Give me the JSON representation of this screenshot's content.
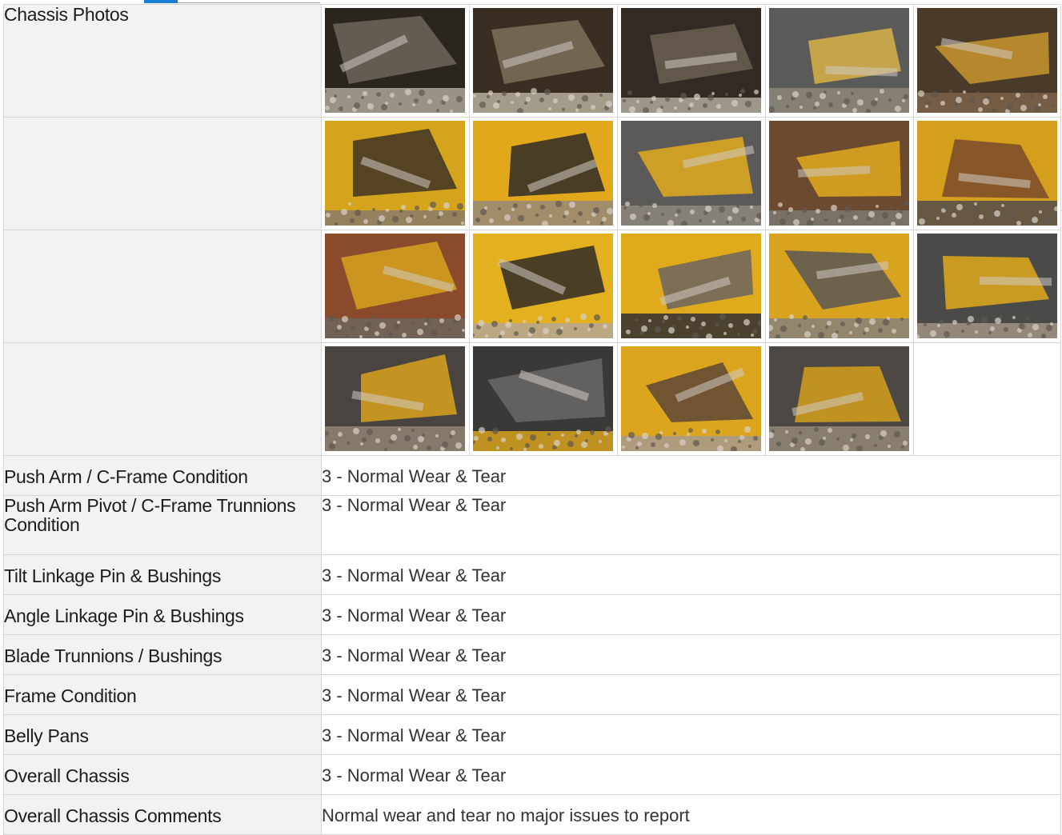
{
  "section": {
    "photos_label": "Chassis Photos"
  },
  "photos": {
    "rows": [
      [
        {
          "icon": "chassis-underside-photo",
          "tone": [
            "#2b2520",
            "#6e665c",
            "#a49e92"
          ]
        },
        {
          "icon": "chassis-underside-photo",
          "tone": [
            "#3a2e22",
            "#7d6e5a",
            "#b0a896"
          ]
        },
        {
          "icon": "chassis-underside-photo",
          "tone": [
            "#322a24",
            "#6b5f52",
            "#a8a296"
          ]
        },
        {
          "icon": "grille-guard-photo",
          "tone": [
            "#5a5a58",
            "#d9b24a",
            "#8a8378"
          ]
        },
        {
          "icon": "linkage-joint-photo",
          "tone": [
            "#4a3a2a",
            "#c9962e",
            "#7a6048"
          ]
        }
      ],
      [
        {
          "icon": "frame-bolt-photo",
          "tone": [
            "#d4a51c",
            "#3d3226",
            "#8d7d66"
          ]
        },
        {
          "icon": "cylinder-mount-photo",
          "tone": [
            "#e0a81a",
            "#2e2b28",
            "#9a8a72"
          ]
        },
        {
          "icon": "track-cleat-photo",
          "tone": [
            "#5c5a58",
            "#e2ab1e",
            "#8a857c"
          ]
        },
        {
          "icon": "track-frame-photo",
          "tone": [
            "#6b4a30",
            "#e0a91f",
            "#7b756c"
          ]
        },
        {
          "icon": "cylinder-track-photo",
          "tone": [
            "#d39f1c",
            "#7a4a2c",
            "#5b5048"
          ]
        }
      ],
      [
        {
          "icon": "track-link-photo",
          "tone": [
            "#8a4a2c",
            "#d6a21e",
            "#6e655a"
          ]
        },
        {
          "icon": "frame-closeup-photo",
          "tone": [
            "#e3b020",
            "#2f2a26",
            "#b6a68c"
          ]
        },
        {
          "icon": "track-side-photo",
          "tone": [
            "#e0aa1d",
            "#6a6560",
            "#3a3532"
          ]
        },
        {
          "icon": "push-arm-photo",
          "tone": [
            "#d8a31e",
            "#5a5754",
            "#8b8375"
          ]
        },
        {
          "icon": "blade-arm-photo",
          "tone": [
            "#4a4a48",
            "#e0a91c",
            "#9b8f7e"
          ]
        }
      ],
      [
        {
          "icon": "blade-bottom-photo",
          "tone": [
            "#4a4440",
            "#d8a21c",
            "#8c8070"
          ]
        },
        {
          "icon": "c-frame-photo",
          "tone": [
            "#3b3938",
            "#6a6866",
            "#cf9c1f"
          ]
        },
        {
          "icon": "trunnion-photo",
          "tone": [
            "#dba61e",
            "#5d4636",
            "#a89b86"
          ]
        },
        {
          "icon": "blade-base-photo",
          "tone": [
            "#4d4844",
            "#d5a01c",
            "#8f8472"
          ]
        },
        null
      ]
    ]
  },
  "items": [
    {
      "label": "Push Arm / C-Frame Condition",
      "value": "3 - Normal Wear & Tear"
    },
    {
      "label": "Push Arm Pivot / C-Frame Trunnions Condition",
      "value": "3 - Normal Wear & Tear"
    },
    {
      "label": "Tilt Linkage Pin & Bushings",
      "value": "3 - Normal Wear & Tear"
    },
    {
      "label": "Angle Linkage Pin & Bushings",
      "value": "3 - Normal Wear & Tear"
    },
    {
      "label": "Blade Trunnions / Bushings",
      "value": "3 - Normal Wear & Tear"
    },
    {
      "label": "Frame Condition",
      "value": "3 - Normal Wear & Tear"
    },
    {
      "label": "Belly Pans",
      "value": "3 - Normal Wear & Tear"
    },
    {
      "label": "Overall Chassis",
      "value": "3 - Normal Wear & Tear"
    },
    {
      "label": "Overall Chassis Comments",
      "value": "Normal wear and tear no major issues to report"
    }
  ]
}
